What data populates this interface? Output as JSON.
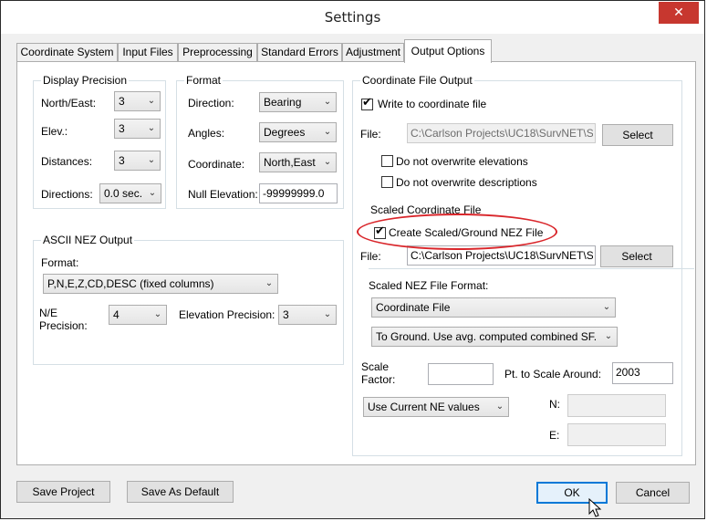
{
  "window": {
    "title": "Settings",
    "close_glyph": "✕"
  },
  "tabs": [
    {
      "label": "Coordinate System"
    },
    {
      "label": "Input Files"
    },
    {
      "label": "Preprocessing"
    },
    {
      "label": "Standard Errors"
    },
    {
      "label": "Adjustment"
    },
    {
      "label": "Output Options"
    }
  ],
  "display_precision": {
    "title": "Display Precision",
    "north_east_label": "North/East:",
    "north_east_value": "3",
    "elev_label": "Elev.:",
    "elev_value": "3",
    "distances_label": "Distances:",
    "distances_value": "3",
    "directions_label": "Directions:",
    "directions_value": "0.0 sec."
  },
  "format": {
    "title": "Format",
    "direction_label": "Direction:",
    "direction_value": "Bearing",
    "angles_label": "Angles:",
    "angles_value": "Degrees",
    "coordinate_label": "Coordinate:",
    "coordinate_value": "North,East",
    "null_elevation_label": "Null Elevation:",
    "null_elevation_value": "-99999999.0"
  },
  "ascii_nez": {
    "title": "ASCII NEZ Output",
    "format_label": "Format:",
    "format_value": "P,N,E,Z,CD,DESC (fixed columns)",
    "ne_precision_label_line1": "N/E",
    "ne_precision_label_line2": "Precision:",
    "ne_precision_value": "4",
    "elevation_precision_label": "Elevation Precision:",
    "elevation_precision_value": "3"
  },
  "coordinate_file_output": {
    "title": "Coordinate File Output",
    "write_label": "Write to coordinate file",
    "write_checked": true,
    "file_label": "File:",
    "file_value": "C:\\Carlson Projects\\UC18\\SurvNET\\S",
    "select_label": "Select",
    "no_overwrite_elev_label": "Do not overwrite elevations",
    "no_overwrite_desc_label": "Do not overwrite descriptions"
  },
  "scaled_coordinate_file": {
    "title": "Scaled Coordinate File",
    "create_label": "Create Scaled/Ground NEZ File",
    "create_checked": true,
    "file_label": "File:",
    "file_value": "C:\\Carlson Projects\\UC18\\SurvNET\\S",
    "select_label": "Select",
    "format_label": "Scaled NEZ File Format:",
    "format_value": "Coordinate File",
    "method_value": "To Ground. Use avg. computed combined SF.",
    "scale_label_line1": "Scale",
    "scale_label_line2": "Factor:",
    "scale_value": "",
    "pt_scale_label": "Pt. to Scale Around:",
    "pt_scale_value": "2003",
    "ne_values_option": "Use Current NE values",
    "n_label": "N:",
    "n_value": "",
    "e_label": "E:",
    "e_value": ""
  },
  "footer": {
    "save_project": "Save Project",
    "save_default": "Save As Default",
    "ok": "OK",
    "cancel": "Cancel"
  },
  "check_glyph": "✔",
  "dropdown_glyph": "⌄",
  "colors": {
    "highlight": "#d9262b",
    "close_button": "#c7372f",
    "primary_border": "#0078d7"
  }
}
